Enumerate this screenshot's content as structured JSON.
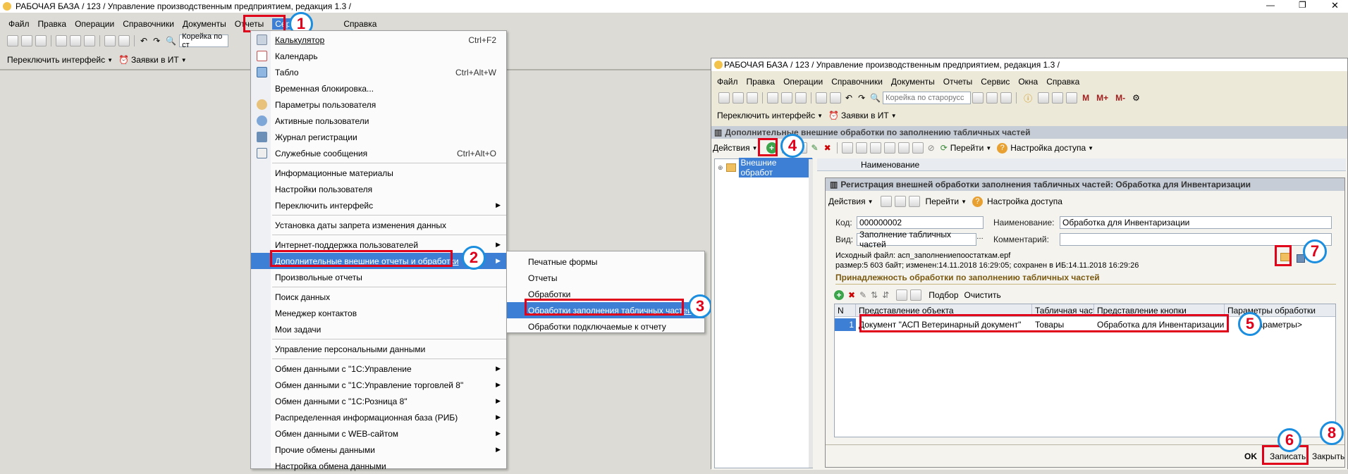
{
  "main_window": {
    "title": "РАБОЧАЯ БАЗА / 123 /  Управление производственным предприятием, редакция 1.3 /",
    "menu": [
      "Файл",
      "Правка",
      "Операции",
      "Справочники",
      "Документы",
      "Отчеты",
      "Сервис",
      "Справка"
    ],
    "search_value": "Корейка по ст",
    "toolbar2": {
      "switch_interface": "Переключить интерфейс",
      "it_requests": "Заявки в ИТ"
    }
  },
  "service_menu": {
    "items": [
      {
        "label": "Калькулятор",
        "shortcut": "Ctrl+F2",
        "icon": "calculator-icon"
      },
      {
        "label": "Календарь",
        "shortcut": "",
        "icon": "calendar-icon"
      },
      {
        "label": "Табло",
        "shortcut": "Ctrl+Alt+W",
        "icon": "board-icon"
      },
      {
        "label": "Временная блокировка...",
        "shortcut": "",
        "icon": "lock-icon"
      },
      {
        "label": "Параметры пользователя",
        "shortcut": "",
        "icon": "user-params-icon"
      },
      {
        "label": "Активные пользователи",
        "shortcut": "",
        "icon": "users-icon"
      },
      {
        "label": "Журнал регистрации",
        "shortcut": "",
        "icon": "journal-icon"
      },
      {
        "label": "Служебные сообщения",
        "shortcut": "Ctrl+Alt+O",
        "icon": "messages-icon"
      },
      {
        "label": "Информационные материалы",
        "shortcut": ""
      },
      {
        "label": "Настройки пользователя",
        "shortcut": ""
      },
      {
        "label": "Переключить интерфейс",
        "shortcut": "",
        "submenu": true
      },
      {
        "label": "Установка даты запрета изменения данных",
        "shortcut": ""
      },
      {
        "label": "Интернет-поддержка пользователей",
        "shortcut": "",
        "submenu": true
      },
      {
        "label": "Дополнительные внешние отчеты и обработки",
        "shortcut": "",
        "submenu": true
      },
      {
        "label": "Произвольные отчеты",
        "shortcut": ""
      },
      {
        "label": "Поиск данных",
        "shortcut": ""
      },
      {
        "label": "Менеджер контактов",
        "shortcut": ""
      },
      {
        "label": "Мои задачи",
        "shortcut": ""
      },
      {
        "label": "Управление персональными данными",
        "shortcut": ""
      },
      {
        "label": "Обмен данными с \"1С:Управление",
        "shortcut": "",
        "submenu": true
      },
      {
        "label": "Обмен данными с \"1С:Управление торговлей 8\"",
        "shortcut": "",
        "submenu": true
      },
      {
        "label": "Обмен данными с \"1С:Розница 8\"",
        "shortcut": "",
        "submenu": true
      },
      {
        "label": "Распределенная информационная база (РИБ)",
        "shortcut": "",
        "submenu": true
      },
      {
        "label": "Обмен данными с WEB-сайтом",
        "shortcut": "",
        "submenu": true
      },
      {
        "label": "Прочие обмены данными",
        "shortcut": "",
        "submenu": true
      },
      {
        "label": "Настройка обмена данными",
        "shortcut": ""
      }
    ]
  },
  "submenu": {
    "items": [
      "Печатные формы",
      "Отчеты",
      "Обработки",
      "Обработки заполнения табличных частей",
      "Обработки подключаемые к отчету"
    ]
  },
  "second_window": {
    "title": "РАБОЧАЯ БАЗА / 123 /  Управление производственным предприятием, редакция 1.3 /",
    "menu": [
      "Файл",
      "Правка",
      "Операции",
      "Справочники",
      "Документы",
      "Отчеты",
      "Сервис",
      "Окна",
      "Справка"
    ],
    "search_placeholder": "Корейка по старорусс",
    "toolbar_letters": [
      "M",
      "M+",
      "M-"
    ],
    "switch_interface": "Переключить интерфейс",
    "it_requests": "Заявки в ИТ",
    "list_title": "Дополнительные внешние обработки по заполнению табличных частей",
    "actions": "Действия",
    "goto": "Перейти",
    "access": "Настройка доступа",
    "tree_item": "Внешние обработ",
    "col_name": "Наименование"
  },
  "form": {
    "title": "Регистрация внешней обработки заполнения табличных частей: Обработка для Инвентаризации",
    "actions": "Действия",
    "goto": "Перейти",
    "access": "Настройка доступа",
    "code_label": "Код:",
    "code": "000000002",
    "name_label": "Наименование:",
    "name": "Обработка для Инвентаризации",
    "kind_label": "Вид:",
    "kind": "Заполнение табличных частей",
    "comment_label": "Комментарий:",
    "comment": "",
    "source_line1": "Исходный файл: асп_заполнениепоостаткам.epf",
    "source_line2": "размер:5 603 байт; изменен:14.11.2018 16:29:05; сохранен в ИБ:14.11.2018 16:29:26",
    "section": "Принадлежность обработки по заполнению табличных частей",
    "pick": "Подбор",
    "clear": "Очистить",
    "columns": [
      "N",
      "Представление объекта",
      "Табличная часть",
      "Представление кнопки",
      "Параметры обработки"
    ],
    "row": {
      "n": "1",
      "object": "Документ \"АСП Ветеринарный документ\"",
      "part": "Товары",
      "button": "Обработка для Инвентаризации",
      "params": "<параметры>"
    },
    "ok": "OK",
    "save": "Записать",
    "close": "Закрыть"
  },
  "badges": [
    "1",
    "2",
    "3",
    "4",
    "5",
    "6",
    "7",
    "8"
  ],
  "colors": {
    "highlight_box": "#e0001a",
    "badge_ring": "#1b8ee0",
    "selection": "#3d7fd4"
  }
}
